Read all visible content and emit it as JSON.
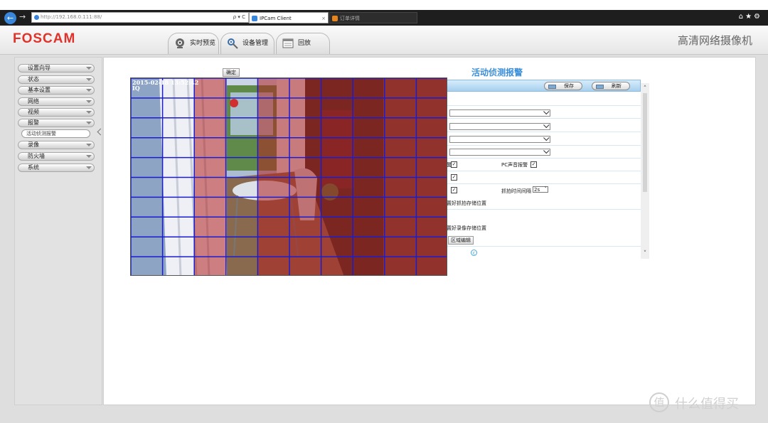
{
  "browser": {
    "url": "http://192.168.0.111:88/",
    "address_tools": "ρ ▾ C",
    "tabs": [
      {
        "title": "IPCam Client",
        "active": true
      },
      {
        "title": "订单详情",
        "active": false
      }
    ],
    "right_icons": "⌂★⚙"
  },
  "header": {
    "logo": "FOSCAM",
    "tabs": [
      {
        "label": "实时预览",
        "icon": "camera-icon"
      },
      {
        "label": "设备管理",
        "icon": "settings-gear-icon"
      },
      {
        "label": "回放",
        "icon": "playback-icon"
      }
    ],
    "brand": "高清网络摄像机"
  },
  "sidebar": {
    "items": [
      {
        "label": "设置向导"
      },
      {
        "label": "状态"
      },
      {
        "label": "基本设置"
      },
      {
        "label": "网络"
      },
      {
        "label": "视频"
      },
      {
        "label": "报警"
      },
      {
        "label": "活动侦测报警",
        "sub": true
      },
      {
        "label": "录像"
      },
      {
        "label": "防火墙"
      },
      {
        "label": "系统"
      }
    ]
  },
  "panel": {
    "title": "活动侦测报警",
    "save": "保存",
    "refresh": "刷新",
    "checkbox_fragment": "警",
    "pc_sound_alarm": "PC声音报警",
    "capture_interval_label": "抓拍时间间隔",
    "capture_interval_value": "2s",
    "snapshot_storage_note": "置好抓拍存储位置",
    "recording_storage_note": "置好录像存储位置",
    "area_edit": "区域编辑",
    "info_icon": "info-icon"
  },
  "camera": {
    "confirm": "确定",
    "timestamp": "2015-02-18 13:52:42",
    "overlay_text": "IQ",
    "grid_cols": 10,
    "grid_rows": 10,
    "selected_cols": [
      2,
      4,
      5,
      6,
      7,
      8,
      9
    ],
    "colors": {
      "grid": "#1c1ccf",
      "selected": "#b02020"
    }
  },
  "watermark": {
    "icon_char": "值",
    "text": "什么值得买"
  }
}
